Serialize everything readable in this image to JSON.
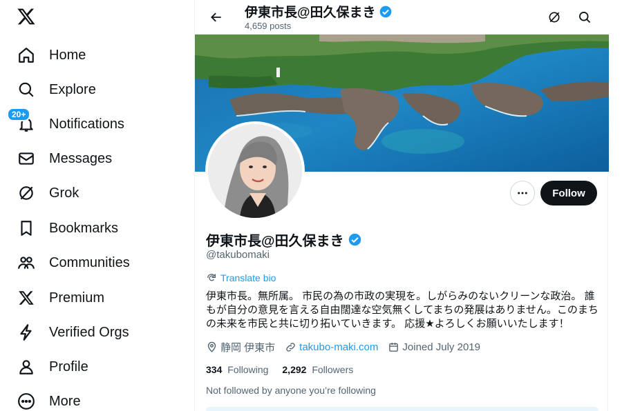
{
  "sidebar": {
    "notifications_badge": "20+",
    "items": [
      {
        "label": "Home",
        "icon": "home-icon"
      },
      {
        "label": "Explore",
        "icon": "search-icon"
      },
      {
        "label": "Notifications",
        "icon": "bell-icon"
      },
      {
        "label": "Messages",
        "icon": "envelope-icon"
      },
      {
        "label": "Grok",
        "icon": "grok-icon"
      },
      {
        "label": "Bookmarks",
        "icon": "bookmark-icon"
      },
      {
        "label": "Communities",
        "icon": "people-icon"
      },
      {
        "label": "Premium",
        "icon": "x-logo-icon"
      },
      {
        "label": "Verified Orgs",
        "icon": "lightning-icon"
      },
      {
        "label": "Profile",
        "icon": "person-icon"
      },
      {
        "label": "More",
        "icon": "more-circle-icon"
      }
    ]
  },
  "header": {
    "title": "伊東市長@田久保まき",
    "posts_count": "4,659 posts"
  },
  "profile": {
    "name": "伊東市長@田久保まき",
    "handle": "@takubomaki",
    "translate_label": "Translate bio",
    "bio": "伊東市長。無所属。 市民の為の市政の実現を。しがらみのないクリーンな政治。 誰もが自分の意見を言える自由闊達な空気無くしてまちの発展はありません。このまちの未来を市民と共に切り拓いていきます。 応援★よろしくお願いいたします！",
    "location": "静岡 伊東市",
    "website": "takubo-maki.com",
    "joined": "Joined July 2019",
    "following_count": "334",
    "following_label": "Following",
    "followers_count": "2,292",
    "followers_label": "Followers",
    "not_followed": "Not followed by anyone you’re following",
    "follow_button": "Follow"
  },
  "colors": {
    "accent": "#1d9bf0",
    "text": "#0f1419",
    "muted": "#536471",
    "button_dark": "#0f1419"
  }
}
